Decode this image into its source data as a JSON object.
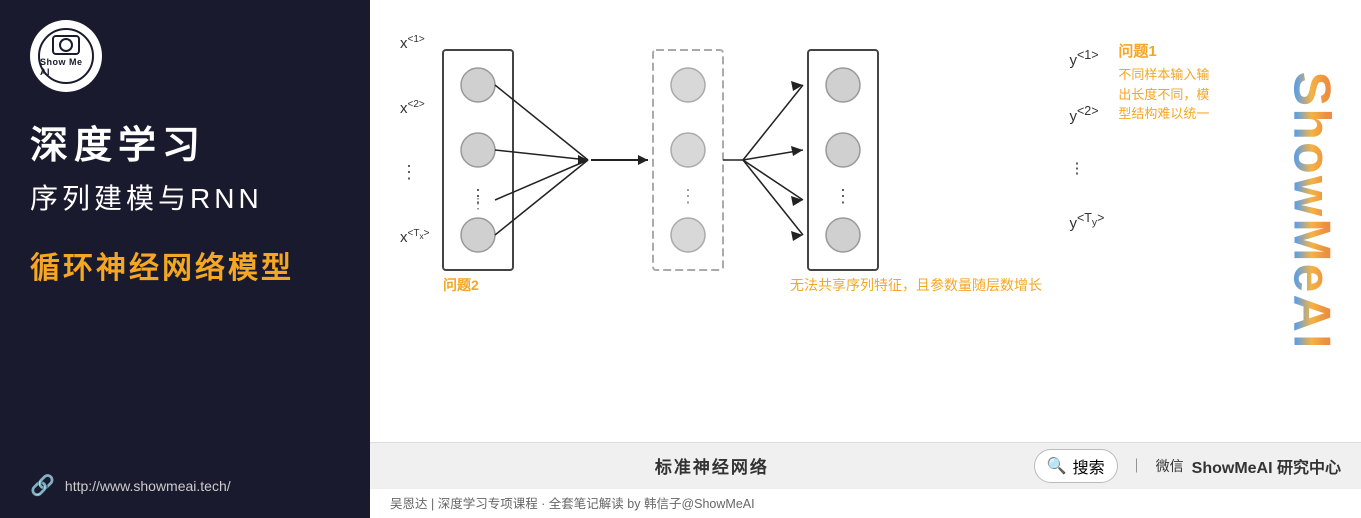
{
  "left": {
    "logo_text": "Show Me AI",
    "logo_icon": "⊙",
    "main_title": "深度学习",
    "sub_title": "序列建模与RNN",
    "highlight": "循环神经网络模型",
    "url": "http://www.showmeai.tech/"
  },
  "diagram": {
    "inputs": [
      "x<1>",
      "x<2>",
      "⋮",
      "x<Tₓ>"
    ],
    "outputs": [
      "y<1>",
      "y<2>",
      "⋮",
      "y<Tᵧ>"
    ],
    "problem1_title": "问题1",
    "problem1_desc": "不同样本输入输出长度不同，模型结构难以统一",
    "problem2_title": "问题2",
    "problem2_desc": "无法共享序列特征，且参数量随层数增长"
  },
  "bottom": {
    "center_label": "标准神经网络",
    "search_placeholder": "搜索",
    "divider": "｜",
    "wechat": "微信",
    "brand": "ShowMeAI 研究中心"
  },
  "footer": {
    "text": "吴恩达 | 深度学习专项课程 · 全套笔记解读 by 韩信子@ShowMeAI"
  },
  "watermark": {
    "text": "ShowMeAI"
  }
}
